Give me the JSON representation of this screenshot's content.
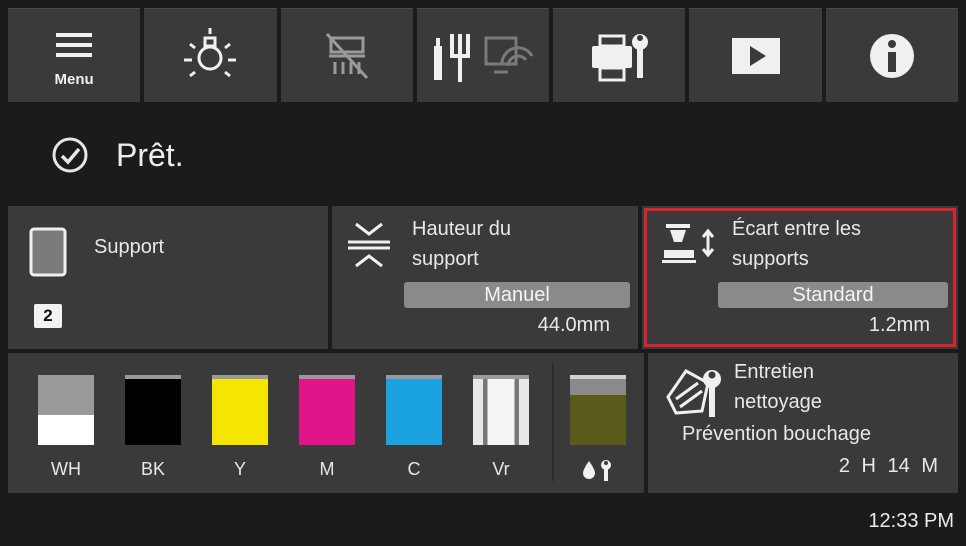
{
  "toolbar": {
    "menu_label": "Menu"
  },
  "status": {
    "text": "Prêt."
  },
  "support_panel": {
    "label": "Support",
    "badge": "2"
  },
  "height_panel": {
    "title_line1": "Hauteur du",
    "title_line2": "support",
    "mode": "Manuel",
    "value": "44.0mm"
  },
  "gap_panel": {
    "title_line1": "Écart entre les",
    "title_line2": "supports",
    "mode": "Standard",
    "value": "1.2mm",
    "highlight_color": "#d8242f"
  },
  "inks": [
    {
      "label": "WH",
      "color": "#ffffff",
      "level": 0.45
    },
    {
      "label": "BK",
      "color": "#000000",
      "level": 1.0
    },
    {
      "label": "Y",
      "color": "#f5e600",
      "level": 1.0
    },
    {
      "label": "M",
      "color": "#e0158a",
      "level": 1.0
    },
    {
      "label": "C",
      "color": "#1aa3e0",
      "level": 1.0
    },
    {
      "label": "Vr",
      "color": "#efefef",
      "level": 1.0
    }
  ],
  "maintenance_tank": {
    "color": "#5a5a1a",
    "level": 0.75,
    "icon": "maintenance-tank-icon"
  },
  "maintenance_panel": {
    "title_line1": "Entretien",
    "title_line2": "nettoyage",
    "subtitle": "Prévention bouchage",
    "time": "2 H 14 M"
  },
  "clock": "12:33 PM"
}
